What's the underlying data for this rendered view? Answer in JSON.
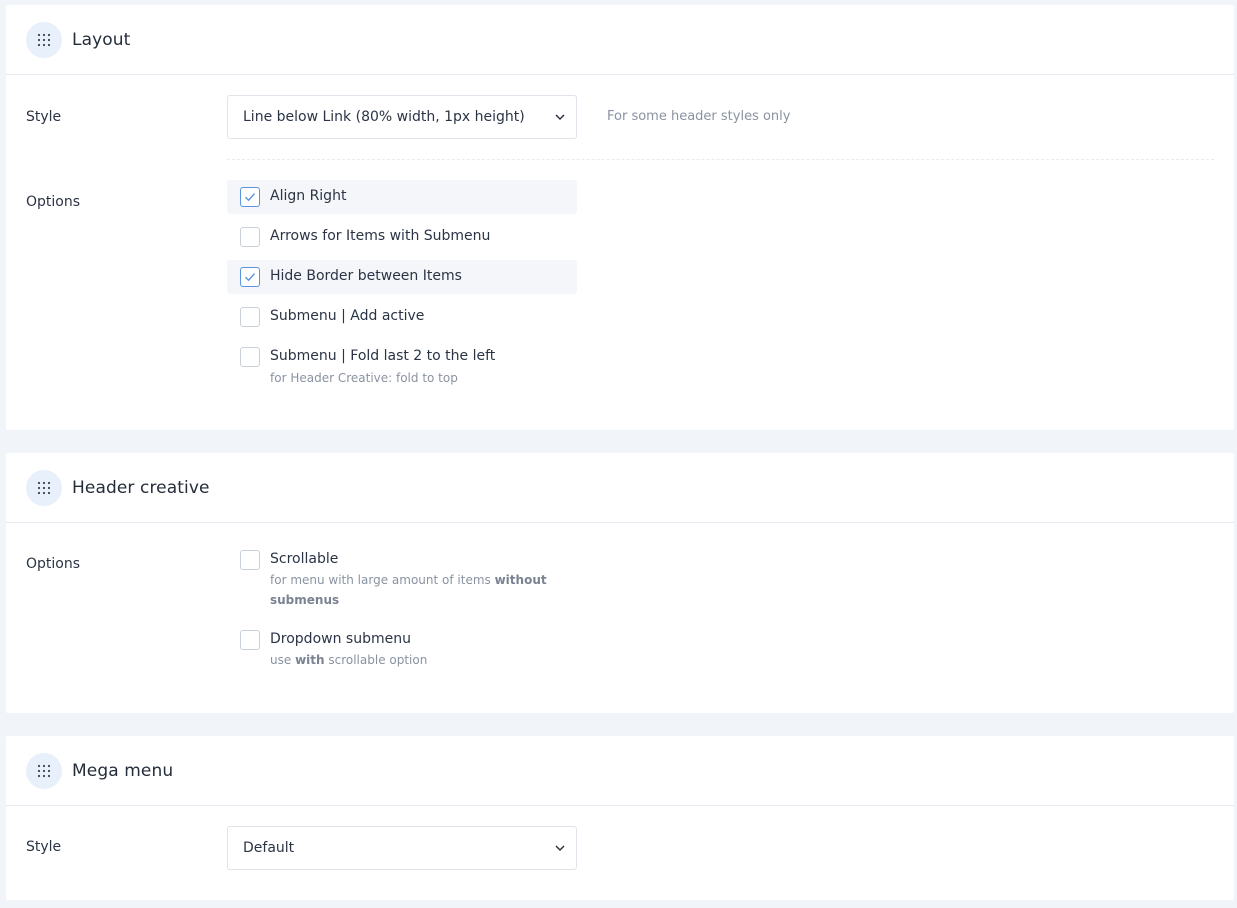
{
  "layout": {
    "title": "Layout",
    "style_label": "Style",
    "style_value": "Line below Link (80% width, 1px height)",
    "style_hint": "For some header styles only",
    "options_label": "Options",
    "options": [
      {
        "label": "Align Right",
        "checked": true
      },
      {
        "label": "Arrows for Items with Submenu",
        "checked": false
      },
      {
        "label": "Hide Border between Items",
        "checked": true
      },
      {
        "label": "Submenu | Add active",
        "checked": false
      },
      {
        "label": "Submenu | Fold last 2 to the left",
        "checked": false,
        "sub": "for Header Creative: fold to top"
      }
    ]
  },
  "header_creative": {
    "title": "Header creative",
    "options_label": "Options",
    "options": [
      {
        "label": "Scrollable",
        "checked": false,
        "sub_pre": "for menu with large amount of items ",
        "sub_bold": "without submenus",
        "sub_post": ""
      },
      {
        "label": "Dropdown submenu",
        "checked": false,
        "sub_pre": "use ",
        "sub_bold": "with",
        "sub_post": " scrollable option"
      }
    ]
  },
  "mega_menu": {
    "title": "Mega menu",
    "style_label": "Style",
    "style_value": "Default"
  },
  "icons": {
    "section": "grip-dots-icon",
    "select": "chevron-down-icon",
    "check": "checkmark-icon"
  },
  "colors": {
    "accent": "#5b95dc",
    "icon_bg": "#e7f0fb",
    "page_bg": "#f1f4f8",
    "hint": "#8a93a1"
  }
}
